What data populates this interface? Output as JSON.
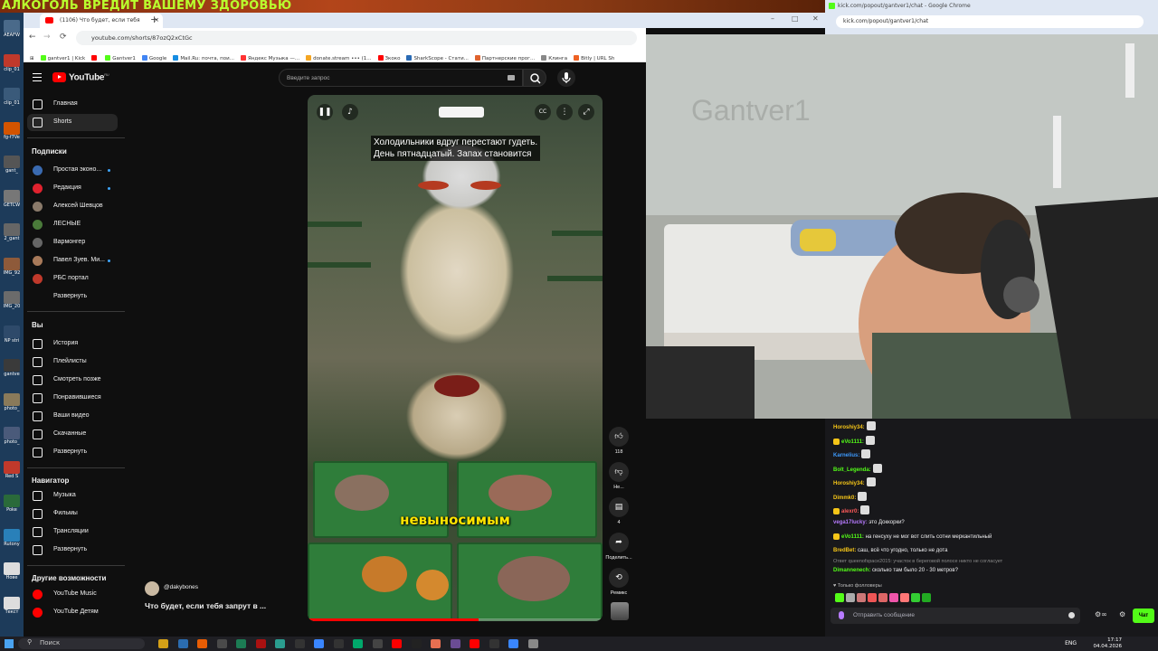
{
  "overlay_banner": "АЛКОГОЛЬ ВРЕДИТ ВАШЕМУ ЗДОРОВЬЮ",
  "desktop_icons": [
    {
      "label": "AEAFW",
      "color": "#4a6a8a"
    },
    {
      "label": "clip_01",
      "color": "#c0392b"
    },
    {
      "label": "clip_01",
      "color": "#3a5a7a"
    },
    {
      "label": "fg-f7Ve",
      "color": "#d35400"
    },
    {
      "label": "gant_",
      "color": "#555"
    },
    {
      "label": "GETCW",
      "color": "#777"
    },
    {
      "label": "2_gant",
      "color": "#666"
    },
    {
      "label": "IMG_92",
      "color": "#8e5a3a"
    },
    {
      "label": "IMG_20",
      "color": "#6b6b6b"
    },
    {
      "label": "NP stri",
      "color": "#2e4a6a"
    },
    {
      "label": "gantve",
      "color": "#3a3a3a"
    },
    {
      "label": "photo_",
      "color": "#8a7a5a"
    },
    {
      "label": "photo_",
      "color": "#4a5a7a"
    },
    {
      "label": "Red S",
      "color": "#c0392b"
    },
    {
      "label": "Poke",
      "color": "#2a6a3a"
    },
    {
      "label": "Rutony",
      "color": "#2980b9"
    },
    {
      "label": "Нове",
      "color": "#ddd"
    },
    {
      "label": "Текст",
      "color": "#ddd"
    }
  ],
  "browser": {
    "tab_title": "(1106) Что будет, если тебя",
    "url": "youtube.com/shorts/87ozQ2xCtGc",
    "bookmarks": [
      {
        "label": "gantver1 | Kick",
        "color": "#53fc18"
      },
      {
        "label": "",
        "color": "#f00"
      },
      {
        "label": "Gantver1",
        "color": "#53fc18"
      },
      {
        "label": "Google",
        "color": "#4285f4"
      },
      {
        "label": "Mail.Ru: почта, пои...",
        "color": "#168de2"
      },
      {
        "label": "Яндекс Музыка —...",
        "color": "#f33"
      },
      {
        "label": "donate.stream ••• (1...",
        "color": "#f5a623"
      },
      {
        "label": "Зкоко",
        "color": "#f00"
      },
      {
        "label": "SharkScope - Стати...",
        "color": "#2a6bb5"
      },
      {
        "label": "Партнерские прог...",
        "color": "#e0632e"
      },
      {
        "label": "Клинга",
        "color": "#888"
      },
      {
        "label": "Bitly | URL Sh",
        "color": "#ee6123"
      }
    ]
  },
  "youtube": {
    "logo_text": "YouTube",
    "logo_region": "RU",
    "search_placeholder": "Введите запрос",
    "sidebar_main": [
      {
        "label": "Главная",
        "icon": "home-icon"
      },
      {
        "label": "Shorts",
        "icon": "shorts-icon"
      }
    ],
    "subs_header": "Подписки",
    "subscriptions": [
      {
        "label": "Простая эконо...",
        "color": "#3a6ab0",
        "dot": true
      },
      {
        "label": "Редакция",
        "color": "#e0222e",
        "dot": true
      },
      {
        "label": "Алексей Шевцов",
        "color": "#8a7a6a",
        "dot": false
      },
      {
        "label": "ЛЕСНЫЕ",
        "color": "#4a7a3a",
        "dot": false
      },
      {
        "label": "Вармонгер",
        "color": "#666",
        "dot": false
      },
      {
        "label": "Павел Зуев. Ми...",
        "color": "#a87a5a",
        "dot": true
      },
      {
        "label": "РБС портал",
        "color": "#c0392b",
        "dot": false
      },
      {
        "label": "Развернуть",
        "color": "",
        "dot": false
      }
    ],
    "you_header": "Вы",
    "you_items": [
      "История",
      "Плейлисты",
      "Смотреть позже",
      "Понравившиеся",
      "Ваши видео",
      "Скачанные",
      "Развернуть"
    ],
    "nav_header": "Навигатор",
    "nav_items": [
      "Музыка",
      "Фильмы",
      "Трансляции",
      "Развернуть"
    ],
    "more_header": "Другие возможности",
    "more_items": [
      "YouTube Music",
      "YouTube Детям"
    ],
    "caption_line1": "Холодильники вдруг перестают гудеть.",
    "caption_line2": "День пятнадцатый. Запах становится",
    "caption_word": "невыносимым",
    "progress": 0.58,
    "like_count": "118",
    "dislike_label": "Не...",
    "comment_count": "4",
    "share_label": "Поделить...",
    "remix_label": "Ремикс",
    "channel": "@dakybones",
    "video_title": "Что будет, если тебя запрут в ..."
  },
  "chat_window": {
    "title": "kick.com/popout/gantver1/chat - Google Chrome",
    "url": "kick.com/popout/gantver1/chat"
  },
  "webcam": {
    "wall_text": "Gantver1"
  },
  "chat": {
    "messages": [
      {
        "user": "Horoshiy34:",
        "color": "#f5c518",
        "text": "",
        "badge": false,
        "emote": true
      },
      {
        "user": "eVo1111:",
        "color": "#53fc18",
        "text": "",
        "badge": true,
        "emote": true
      },
      {
        "user": "Karnelius:",
        "color": "#3d9bff",
        "text": "",
        "badge": false,
        "emote": true
      },
      {
        "user": "Bolt_Legenda:",
        "color": "#53fc18",
        "text": "",
        "badge": false,
        "emote": true
      },
      {
        "user": "Horoshiy34:",
        "color": "#f5c518",
        "text": "",
        "badge": false,
        "emote": true
      },
      {
        "user": "Dimmk0:",
        "color": "#f5c518",
        "text": "",
        "badge": false,
        "emote": true
      },
      {
        "user": "alexr0:",
        "color": "#ff5a5a",
        "text": "",
        "badge": true,
        "emote": true
      },
      {
        "user": "vega17lucky:",
        "color": "#b77bff",
        "text": "это Доккорки?",
        "badge": false,
        "emote": false
      },
      {
        "user": "eVo1111:",
        "color": "#53fc18",
        "text": "на генсуху не мог вот слить сотни меркантильный",
        "badge": true,
        "emote": false
      },
      {
        "user": "BredBet:",
        "color": "#f5c518",
        "text": "саш, всё что угодно, только не дота",
        "badge": false,
        "emote": false
      }
    ],
    "reply_preview": "Ответ queenofspace2015: участок в береговой полосе никто не согласует",
    "reply_user": "Dimannenech:",
    "reply_text": "сколько там было 20 - 30 метров?",
    "followers_only": "Только фолловеры",
    "input_placeholder": "Отправить сообщение",
    "send_label": "Чат"
  },
  "taskbar": {
    "search_label": "Поиск",
    "lang": "ENG",
    "time": "17:17",
    "date": "04.04.2026"
  }
}
